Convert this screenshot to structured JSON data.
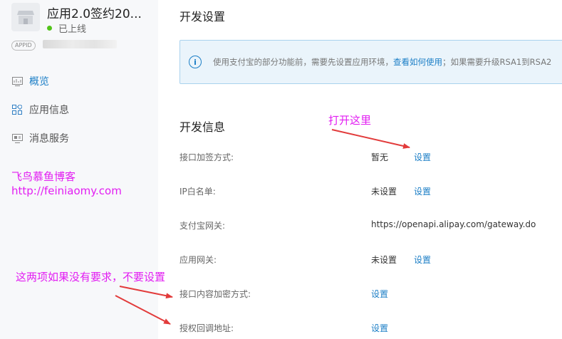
{
  "app": {
    "name": "应用2.0签约20...",
    "status": "已上线",
    "appid_label": "APPID",
    "status_color": "#52c41a"
  },
  "nav": {
    "items": [
      {
        "label": "概览",
        "icon": "dashboard-icon",
        "active": true
      },
      {
        "label": "应用信息",
        "icon": "grid-icon",
        "active": false
      },
      {
        "label": "消息服务",
        "icon": "monitor-icon",
        "active": false
      }
    ]
  },
  "watermark": {
    "line1": "飞鸟慕鱼博客",
    "line2": "http://feiniaomy.com"
  },
  "main": {
    "title": "开发设置",
    "notice": {
      "text_before": "使用支付宝的部分功能前，需要先设置应用环境，",
      "link": "查看如何使用",
      "text_after": "；如果需要升级RSA1到RSA2"
    },
    "section_title": "开发信息",
    "rows": [
      {
        "label": "接口加签方式:",
        "value": "暂无",
        "link": "设置"
      },
      {
        "label": "IP白名单:",
        "value": "未设置",
        "link": "设置"
      },
      {
        "label": "支付宝网关:",
        "value": "https://openapi.alipay.com/gateway.do",
        "link": ""
      },
      {
        "label": "应用网关:",
        "value": "未设置",
        "link": "设置"
      },
      {
        "label": "接口内容加密方式:",
        "value": "",
        "link": "设置"
      },
      {
        "label": "授权回调地址:",
        "value": "",
        "link": "设置"
      }
    ]
  },
  "annotations": {
    "open_here": "打开这里",
    "no_setting": "这两项如果没有要求，不要设置"
  },
  "colors": {
    "accent": "#1b7ec6",
    "annotation": "#e21df2",
    "arrow": "#e23b3b"
  }
}
